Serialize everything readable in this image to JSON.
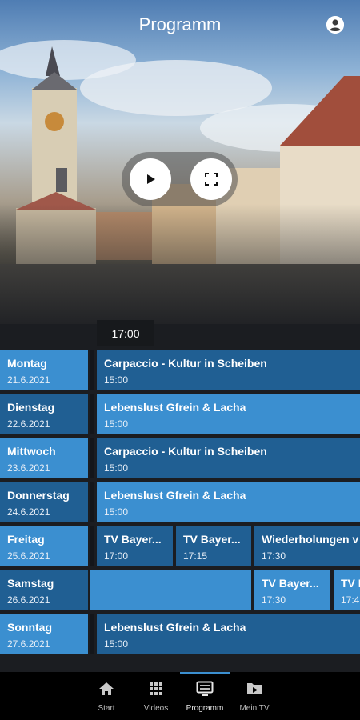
{
  "header": {
    "title": "Programm",
    "profile_icon": "account-circle-icon"
  },
  "player": {
    "play_icon": "play-icon",
    "fullscreen_icon": "fullscreen-icon"
  },
  "schedule": {
    "current_time": "17:00",
    "days": [
      {
        "name": "Montag",
        "date": "21.6.2021",
        "programs": [
          {
            "title": "Carpaccio - Kultur in Scheiben",
            "time": "15:00"
          }
        ]
      },
      {
        "name": "Dienstag",
        "date": "22.6.2021",
        "programs": [
          {
            "title": "Lebenslust Gfrein & Lacha",
            "time": "15:00"
          }
        ]
      },
      {
        "name": "Mittwoch",
        "date": "23.6.2021",
        "programs": [
          {
            "title": "Carpaccio - Kultur in Scheiben",
            "time": "15:00"
          }
        ]
      },
      {
        "name": "Donnerstag",
        "date": "24.6.2021",
        "programs": [
          {
            "title": "Lebenslust Gfrein & Lacha",
            "time": "15:00"
          }
        ]
      },
      {
        "name": "Freitag",
        "date": "25.6.2021",
        "programs": [
          {
            "title": "TV Bayer...",
            "time": "17:00"
          },
          {
            "title": "TV Bayer...",
            "time": "17:15"
          },
          {
            "title": "Wiederholungen v",
            "time": "17:30"
          }
        ]
      },
      {
        "name": "Samstag",
        "date": "26.6.2021",
        "programs": [
          {
            "title": "",
            "time": ""
          },
          {
            "title": "TV Bayer...",
            "time": "17:30"
          },
          {
            "title": "TV I",
            "time": "17:4"
          }
        ]
      },
      {
        "name": "Sonntag",
        "date": "27.6.2021",
        "programs": [
          {
            "title": "Lebenslust Gfrein & Lacha",
            "time": "15:00"
          }
        ]
      }
    ]
  },
  "nav": {
    "items": [
      {
        "label": "Start",
        "icon": "home-icon"
      },
      {
        "label": "Videos",
        "icon": "grid-icon"
      },
      {
        "label": "Programm",
        "icon": "tv-guide-icon"
      },
      {
        "label": "Mein TV",
        "icon": "folder-icon"
      }
    ],
    "active": "Programm"
  },
  "colors": {
    "accent": "#3b8fd0",
    "cell_dark": "#205f93",
    "background": "#1b1d21"
  }
}
